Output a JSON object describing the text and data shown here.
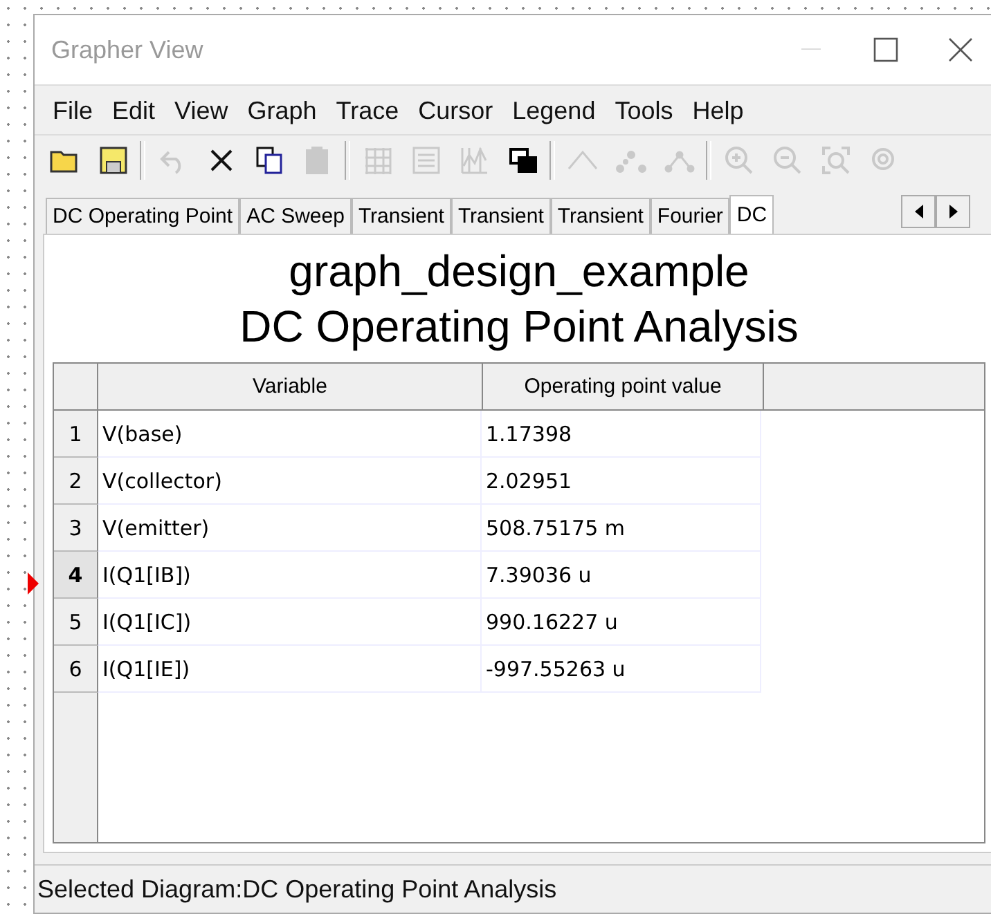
{
  "window": {
    "title": "Grapher View"
  },
  "menu": [
    "File",
    "Edit",
    "View",
    "Graph",
    "Trace",
    "Cursor",
    "Legend",
    "Tools",
    "Help"
  ],
  "toolbar": [
    {
      "kind": "open",
      "disabled": false
    },
    {
      "kind": "save",
      "disabled": false
    },
    {
      "kind": "sep"
    },
    {
      "kind": "undo",
      "disabled": true
    },
    {
      "kind": "delete",
      "disabled": false
    },
    {
      "kind": "copy",
      "disabled": false
    },
    {
      "kind": "paste",
      "disabled": true
    },
    {
      "kind": "sep"
    },
    {
      "kind": "grid",
      "disabled": true
    },
    {
      "kind": "legend",
      "disabled": true
    },
    {
      "kind": "cursors",
      "disabled": true
    },
    {
      "kind": "overlay",
      "disabled": false
    },
    {
      "kind": "sep"
    },
    {
      "kind": "line",
      "disabled": true
    },
    {
      "kind": "points",
      "disabled": true
    },
    {
      "kind": "linepoints",
      "disabled": true
    },
    {
      "kind": "sep"
    },
    {
      "kind": "zoomin",
      "disabled": true
    },
    {
      "kind": "zoomout",
      "disabled": true
    },
    {
      "kind": "zoomfit",
      "disabled": true
    },
    {
      "kind": "zoomrestore",
      "disabled": true
    }
  ],
  "tabs": [
    {
      "label": "DC Operating Point",
      "selected": false
    },
    {
      "label": "AC Sweep",
      "selected": false
    },
    {
      "label": "Transient",
      "selected": false
    },
    {
      "label": "Transient",
      "selected": false
    },
    {
      "label": "Transient",
      "selected": false
    },
    {
      "label": "Fourier",
      "selected": false
    },
    {
      "label": "DC",
      "selected": true
    }
  ],
  "diagram": {
    "title": "graph_design_example",
    "subtitle": "DC Operating Point Analysis"
  },
  "table": {
    "columns": [
      "Variable",
      "Operating point value"
    ],
    "rows": [
      {
        "index": "1",
        "variable": "V(base)",
        "value": "1.17398",
        "current": false
      },
      {
        "index": "2",
        "variable": "V(collector)",
        "value": "2.02951",
        "current": false
      },
      {
        "index": "3",
        "variable": "V(emitter)",
        "value": "508.75175 m",
        "current": false
      },
      {
        "index": "4",
        "variable": "I(Q1[IB])",
        "value": "7.39036 u",
        "current": true
      },
      {
        "index": "5",
        "variable": "I(Q1[IC])",
        "value": "990.16227 u",
        "current": false
      },
      {
        "index": "6",
        "variable": "I(Q1[IE])",
        "value": "-997.55263 u",
        "current": false
      }
    ]
  },
  "status_bar": "Selected Diagram:DC Operating Point Analysis"
}
